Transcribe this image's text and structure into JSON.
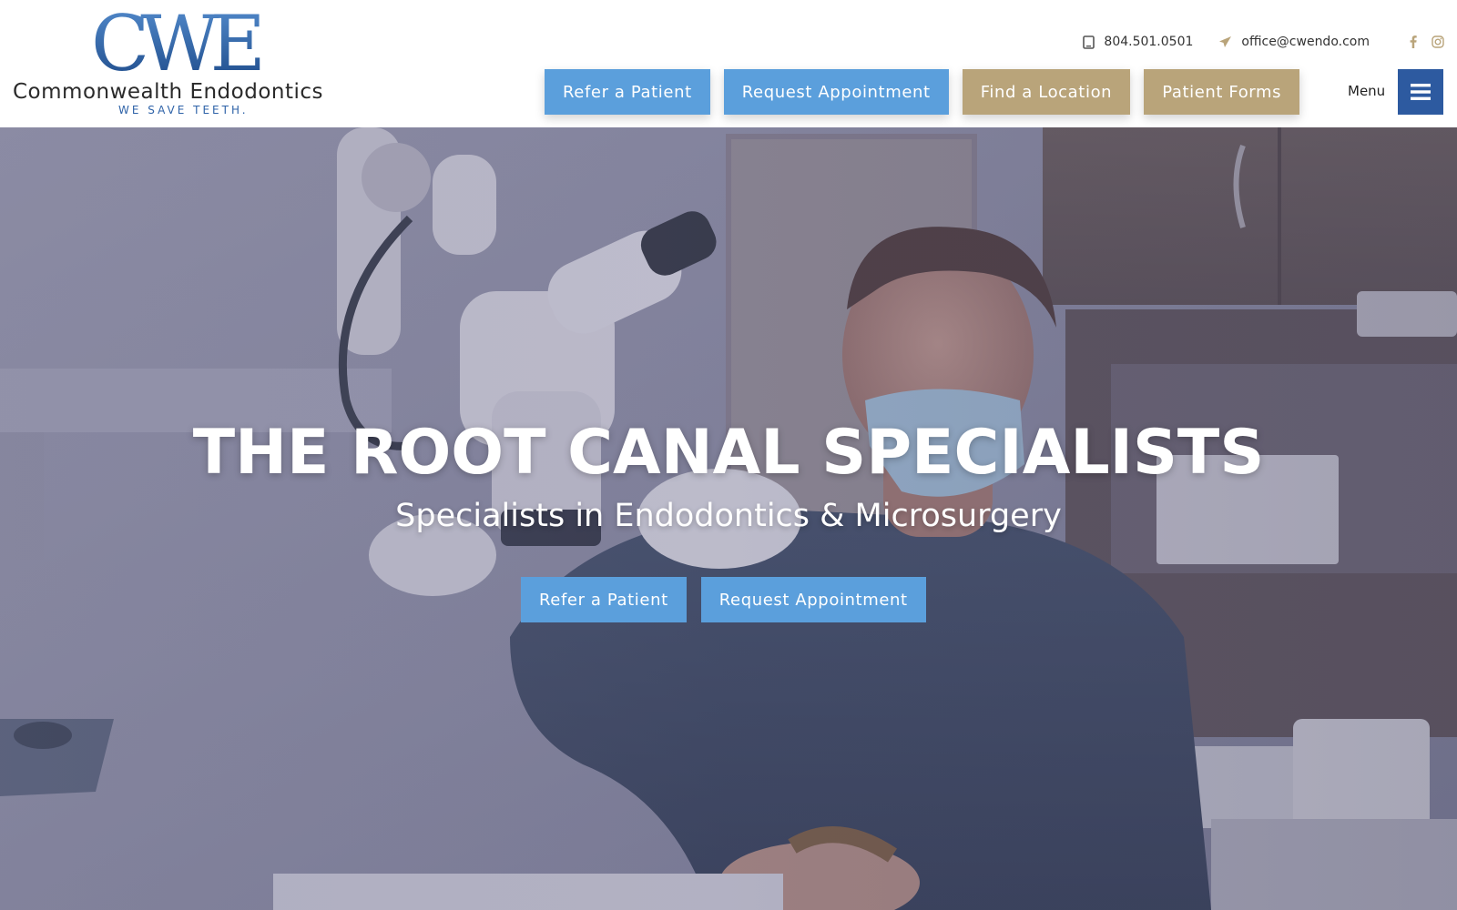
{
  "brand": {
    "logo_mark": "CWE",
    "name": "Commonwealth Endodontics",
    "tagline": "WE SAVE TEETH."
  },
  "contact": {
    "phone": "804.501.0501",
    "phone_icon": "phone-icon",
    "email": "office@cwendo.com",
    "email_icon": "paper-plane-icon",
    "social": [
      "facebook-icon",
      "instagram-icon"
    ]
  },
  "nav": {
    "buttons": [
      {
        "label": "Refer a Patient",
        "style": "blue"
      },
      {
        "label": "Request Appointment",
        "style": "blue"
      },
      {
        "label": "Find a Location",
        "style": "tan"
      },
      {
        "label": "Patient Forms",
        "style": "tan"
      }
    ],
    "menu_label": "Menu",
    "menu_icon": "hamburger-icon"
  },
  "hero": {
    "title": "THE ROOT CANAL SPECIALISTS",
    "subtitle": "Specialists in Endodontics & Microsurgery",
    "buttons": [
      {
        "label": "Refer a Patient"
      },
      {
        "label": "Request Appointment"
      }
    ]
  },
  "colors": {
    "accent_blue": "#5b9fdc",
    "accent_tan": "#b9a47a",
    "brand_navy": "#2d5aa0"
  }
}
